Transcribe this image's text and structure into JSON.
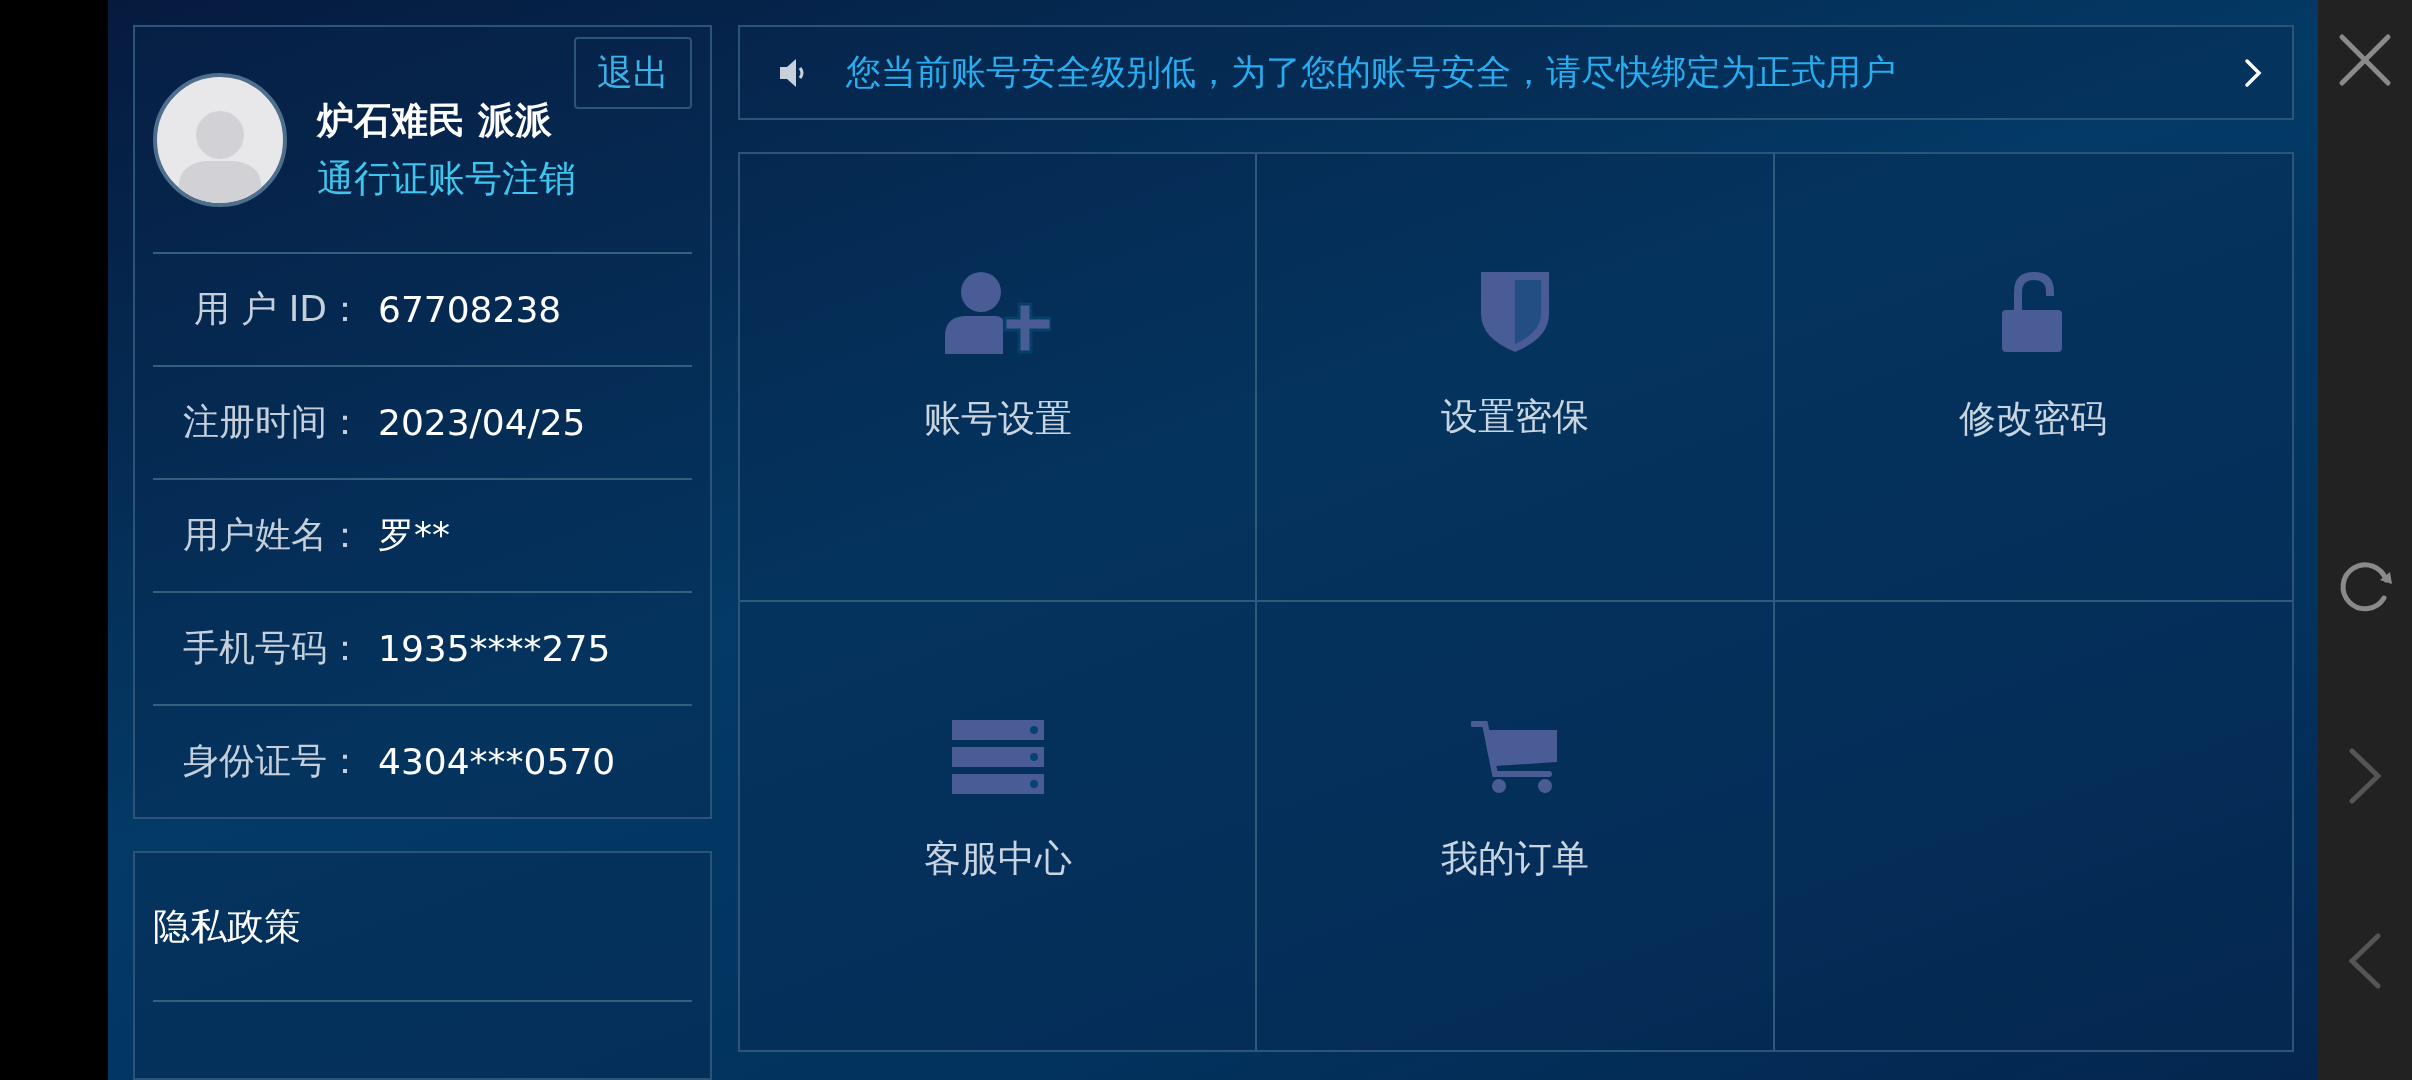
{
  "profile": {
    "logout_button": "退出",
    "name": "炉石难民 派派",
    "cancel_link": "通行证账号注销",
    "fields": [
      {
        "label": "用 户 ID：",
        "value": "67708238"
      },
      {
        "label": "注册时间：",
        "value": "2023/04/25"
      },
      {
        "label": "用户姓名：",
        "value": "罗**"
      },
      {
        "label": "手机号码：",
        "value": "1935****275"
      },
      {
        "label": "身份证号：",
        "value": "4304***0570"
      }
    ]
  },
  "links": [
    "隐私政策"
  ],
  "notice": {
    "text": "您当前账号安全级别低，为了您的账号安全，请尽快绑定为正式用户"
  },
  "menu": [
    {
      "label": "账号设置",
      "kind": "user-add"
    },
    {
      "label": "设置密保",
      "kind": "shield"
    },
    {
      "label": "修改密码",
      "kind": "unlock"
    },
    {
      "label": "客服中心",
      "kind": "server"
    },
    {
      "label": "我的订单",
      "kind": "cart"
    }
  ]
}
